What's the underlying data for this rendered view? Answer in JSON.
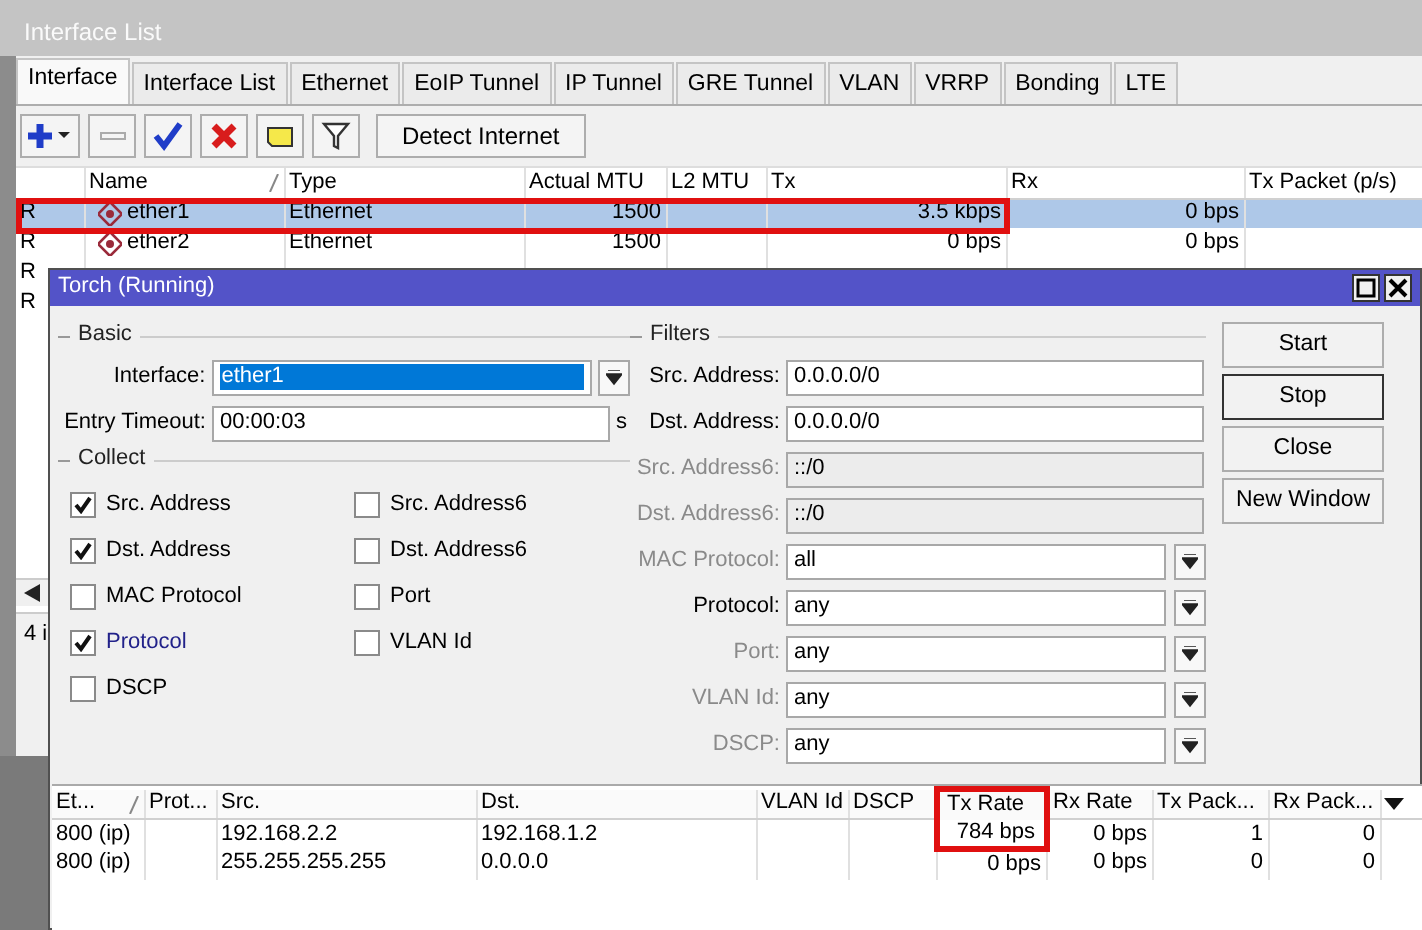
{
  "interface_window": {
    "title": "Interface List",
    "tabs": [
      {
        "label": "Interface",
        "selected": true
      },
      {
        "label": "Interface List",
        "selected": false
      },
      {
        "label": "Ethernet",
        "selected": false
      },
      {
        "label": "EoIP Tunnel",
        "selected": false
      },
      {
        "label": "IP Tunnel",
        "selected": false
      },
      {
        "label": "GRE Tunnel",
        "selected": false
      },
      {
        "label": "VLAN",
        "selected": false
      },
      {
        "label": "VRRP",
        "selected": false
      },
      {
        "label": "Bonding",
        "selected": false
      },
      {
        "label": "LTE",
        "selected": false
      }
    ],
    "toolbar": {
      "detect_button": "Detect Internet"
    },
    "table": {
      "columns": [
        {
          "label": "Name",
          "sorted": true
        },
        {
          "label": "Type",
          "sorted": false
        },
        {
          "label": "Actual MTU",
          "sorted": false
        },
        {
          "label": "L2 MTU",
          "sorted": false
        },
        {
          "label": "Tx",
          "sorted": false
        },
        {
          "label": "Rx",
          "sorted": false
        },
        {
          "label": "Tx Packet (p/s)",
          "sorted": false
        }
      ],
      "rows": [
        {
          "flag": "R",
          "name": "ether1",
          "type": "Ethernet",
          "actual_mtu": "1500",
          "tx": "3.5 kbps",
          "rx": "0 bps",
          "selected": true,
          "highlighted": true
        },
        {
          "flag": "R",
          "name": "ether2",
          "type": "Ethernet",
          "actual_mtu": "1500",
          "tx": "0 bps",
          "rx": "0 bps",
          "selected": false,
          "highlighted": false
        },
        {
          "flag": "R",
          "selected": false,
          "highlighted": false
        },
        {
          "flag": "R",
          "selected": false,
          "highlighted": false
        }
      ]
    },
    "status": "4 i"
  },
  "torch": {
    "title": "Torch (Running)",
    "basic": {
      "legend": "Basic",
      "interface": {
        "label": "Interface:",
        "value": "ether1"
      },
      "entry_timeout": {
        "label": "Entry Timeout:",
        "value": "00:00:03",
        "unit": "s"
      }
    },
    "collect": {
      "legend": "Collect",
      "options": [
        {
          "label": "Src. Address",
          "checked": true,
          "focused": false
        },
        {
          "label": "Src. Address6",
          "checked": false,
          "focused": false
        },
        {
          "label": "Dst. Address",
          "checked": true,
          "focused": false
        },
        {
          "label": "Dst. Address6",
          "checked": false,
          "focused": false
        },
        {
          "label": "MAC Protocol",
          "checked": false,
          "focused": false
        },
        {
          "label": "Port",
          "checked": false,
          "focused": false
        },
        {
          "label": "Protocol",
          "checked": true,
          "focused": true
        },
        {
          "label": "VLAN Id",
          "checked": false,
          "focused": false
        },
        {
          "label": "DSCP",
          "checked": false,
          "focused": false
        }
      ]
    },
    "filters": {
      "legend": "Filters",
      "fields": [
        {
          "kind": "text",
          "label": "Src. Address:",
          "value": "0.0.0.0/0",
          "disabled": false
        },
        {
          "kind": "text",
          "label": "Dst. Address:",
          "value": "0.0.0.0/0",
          "disabled": false
        },
        {
          "kind": "text",
          "label": "Src. Address6:",
          "value": "::/0",
          "disabled": true
        },
        {
          "kind": "text",
          "label": "Dst. Address6:",
          "value": "::/0",
          "disabled": true
        },
        {
          "kind": "select",
          "label": "MAC Protocol:",
          "value": "all",
          "disabled": true
        },
        {
          "kind": "select",
          "label": "Protocol:",
          "value": "any",
          "disabled": false
        },
        {
          "kind": "select",
          "label": "Port:",
          "value": "any",
          "disabled": true
        },
        {
          "kind": "select",
          "label": "VLAN Id:",
          "value": "any",
          "disabled": true
        },
        {
          "kind": "select",
          "label": "DSCP:",
          "value": "any",
          "disabled": true
        }
      ]
    },
    "buttons": [
      {
        "label": "Start",
        "default": false
      },
      {
        "label": "Stop",
        "default": true
      },
      {
        "label": "Close",
        "default": false
      },
      {
        "label": "New Window",
        "default": false
      }
    ],
    "table": {
      "columns": [
        {
          "label": "Et...",
          "sorted": true,
          "highlighted": false
        },
        {
          "label": "Prot...",
          "sorted": false,
          "highlighted": false
        },
        {
          "label": "Src.",
          "sorted": false,
          "highlighted": false
        },
        {
          "label": "Dst.",
          "sorted": false,
          "highlighted": false
        },
        {
          "label": "VLAN Id",
          "sorted": false,
          "highlighted": false
        },
        {
          "label": "DSCP",
          "sorted": false,
          "highlighted": false
        },
        {
          "label": "Tx Rate",
          "sorted": false,
          "highlighted": true
        },
        {
          "label": "Rx Rate",
          "sorted": false,
          "highlighted": false
        },
        {
          "label": "Tx Pack...",
          "sorted": false,
          "highlighted": false
        },
        {
          "label": "Rx Pack...",
          "sorted": false,
          "highlighted": false
        }
      ],
      "rows": [
        {
          "eth": "800 (ip)",
          "src": "192.168.2.2",
          "dst": "192.168.1.2",
          "tx_rate": "784 bps",
          "rx_rate": "0 bps",
          "tx_packets": "1",
          "rx_packets": "0",
          "highlighted": true
        },
        {
          "eth": "800 (ip)",
          "src": "255.255.255.255",
          "dst": "0.0.0.0",
          "tx_rate": "0 bps",
          "rx_rate": "0 bps",
          "tx_packets": "0",
          "rx_packets": "0",
          "highlighted": false
        }
      ]
    }
  }
}
